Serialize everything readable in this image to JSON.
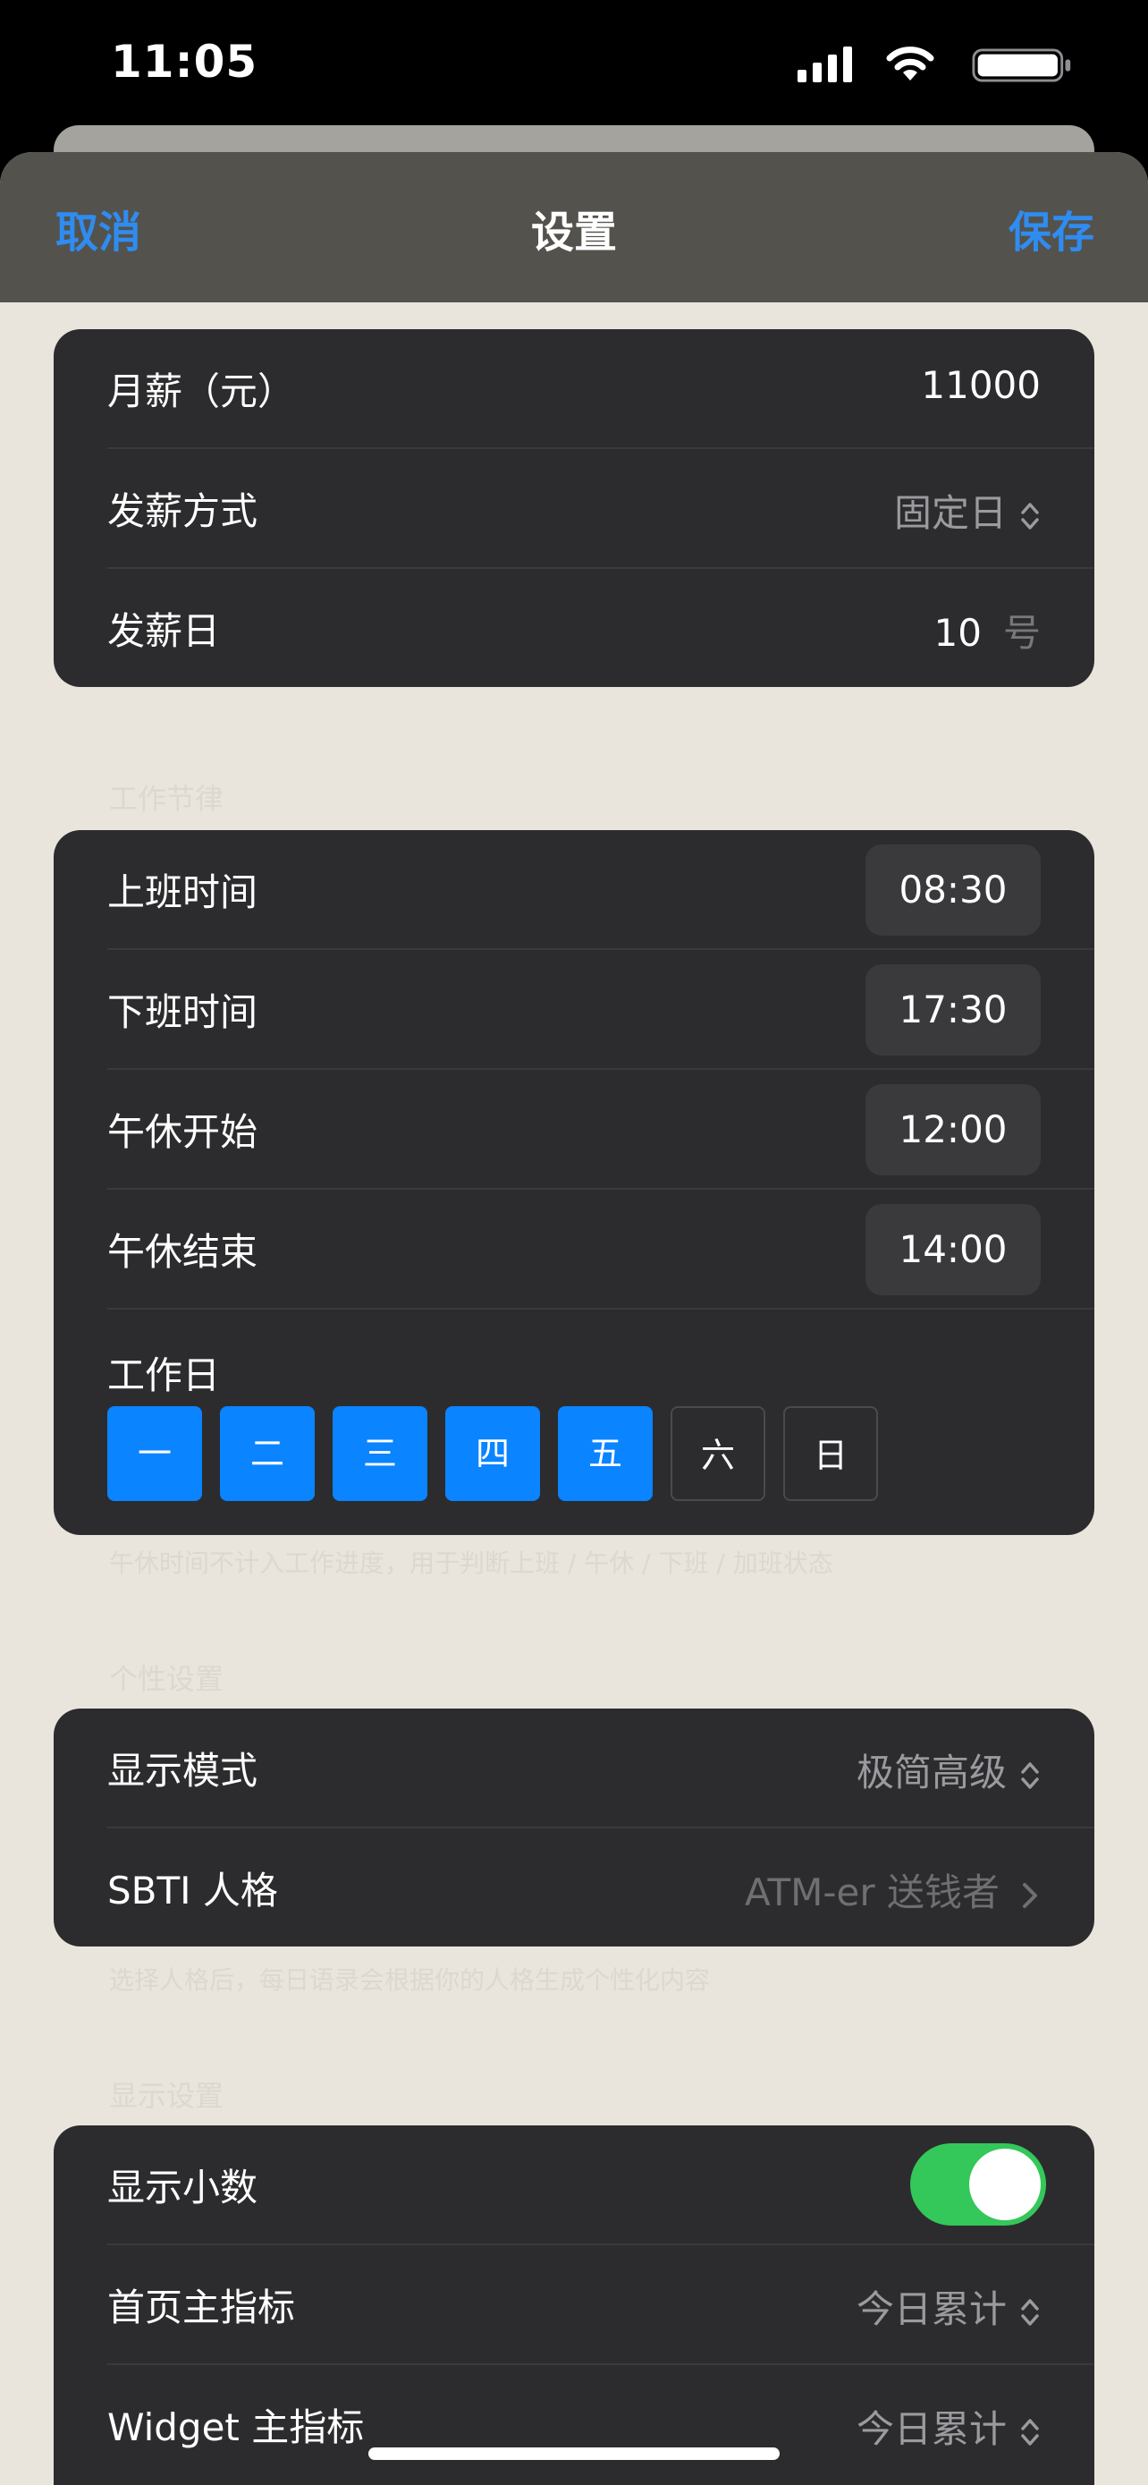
{
  "status_bar": {
    "time": "11:05"
  },
  "nav": {
    "cancel": "取消",
    "title": "设置",
    "save": "保存"
  },
  "salary": {
    "monthly_label": "月薪（元）",
    "monthly_value": "11000",
    "method_label": "发薪方式",
    "method_value": "固定日",
    "day_label": "发薪日",
    "day_value": "10",
    "day_unit": "号"
  },
  "work": {
    "section_header": "工作节律",
    "start_label": "上班时间",
    "start_value": "08:30",
    "end_label": "下班时间",
    "end_value": "17:30",
    "lunch_start_label": "午休开始",
    "lunch_start_value": "12:00",
    "lunch_end_label": "午休结束",
    "lunch_end_value": "14:00",
    "workday_label": "工作日",
    "days": [
      {
        "label": "一",
        "on": true
      },
      {
        "label": "二",
        "on": true
      },
      {
        "label": "三",
        "on": true
      },
      {
        "label": "四",
        "on": true
      },
      {
        "label": "五",
        "on": true
      },
      {
        "label": "六",
        "on": false
      },
      {
        "label": "日",
        "on": false
      }
    ],
    "footer": "午休时间不计入工作进度，用于判断上班 / 午休 / 下班 / 加班状态"
  },
  "personal": {
    "section_header": "个性设置",
    "display_mode_label": "显示模式",
    "display_mode_value": "极简高级",
    "sbti_label": "SBTI 人格",
    "sbti_value": "ATM-er 送钱者",
    "footer": "选择人格后，每日语录会根据你的人格生成个性化内容"
  },
  "display": {
    "section_header": "显示设置",
    "decimals_label": "显示小数",
    "decimals_on": true,
    "home_metric_label": "首页主指标",
    "home_metric_value": "今日累计",
    "widget_metric_label": "Widget 主指标",
    "widget_metric_value": "今日累计"
  },
  "colors": {
    "accent": "#0a84ff",
    "toggle_on": "#34c759",
    "group_bg": "#2c2c2e",
    "sheet_bg": "#e9e5dc"
  }
}
